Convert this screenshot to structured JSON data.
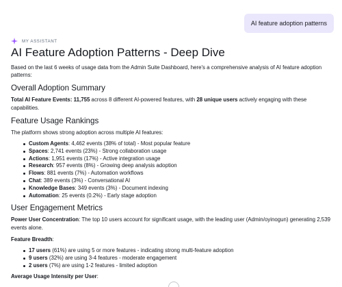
{
  "user_message": "AI feature adoption patterns",
  "assistant": {
    "label": "MY ASSISTANT"
  },
  "title": "AI Feature Adoption Patterns - Deep Dive",
  "intro": "Based on the last 6 weeks of usage data from the Admin Suite Dashboard, here's a comprehensive analysis of AI feature adoption patterns:",
  "overall": {
    "heading": "Overall Adoption Summary",
    "label": "Total AI Feature Events:",
    "total": "11,755",
    "mid": " across 8 different AI-powered features, with ",
    "users": "28 unique users",
    "tail": " actively engaging with these capabilities."
  },
  "rankings": {
    "heading": "Feature Usage Rankings",
    "intro": "The platform shows strong adoption across multiple AI features:",
    "items": [
      {
        "name": "Custom Agents",
        "detail": ": 4,462 events (38% of total) - Most popular feature"
      },
      {
        "name": "Spaces",
        "detail": ": 2,741 events (23%) - Strong collaboration usage"
      },
      {
        "name": "Actions",
        "detail": ": 1,951 events (17%) - Active integration usage"
      },
      {
        "name": "Research",
        "detail": ": 957 events (8%) - Growing deep analysis adoption"
      },
      {
        "name": "Flows",
        "detail": ": 881 events (7%) - Automation workflows"
      },
      {
        "name": "Chat",
        "detail": ": 389 events (3%) - Conversational AI"
      },
      {
        "name": "Knowledge Bases",
        "detail": ": 349 events (3%) - Document indexing"
      },
      {
        "name": "Automation",
        "detail": ": 25 events (0.2%) - Early stage adoption"
      }
    ]
  },
  "engagement": {
    "heading": "User Engagement Metrics",
    "concentration_label": "Power User Concentration",
    "concentration_text": ": The top 10 users account for significant usage, with the leading user (Admin/oyinogun) generating 2,539 events alone.",
    "breadth_label": "Feature Breadth",
    "breadth_colon": ":",
    "breadth_items": [
      {
        "name": "17 users",
        "detail": " (61%) are using 5 or more features - indicating strong multi-feature adoption"
      },
      {
        "name": "9 users",
        "detail": " (32%) are using 3-4 features - moderate engagement"
      },
      {
        "name": "2 users",
        "detail": " (7%) are using 1-2 features - limited adoption"
      }
    ],
    "intensity_label": "Average Usage Intensity per User",
    "intensity_colon": ":"
  },
  "icons": {
    "assistant": "sparkle-icon",
    "scroll": "chevron-down-icon"
  },
  "colors": {
    "user_bubble": "#eae6fb",
    "sparkle": "#9a59ff",
    "text": "#16191f",
    "muted": "#5f6b7a"
  }
}
